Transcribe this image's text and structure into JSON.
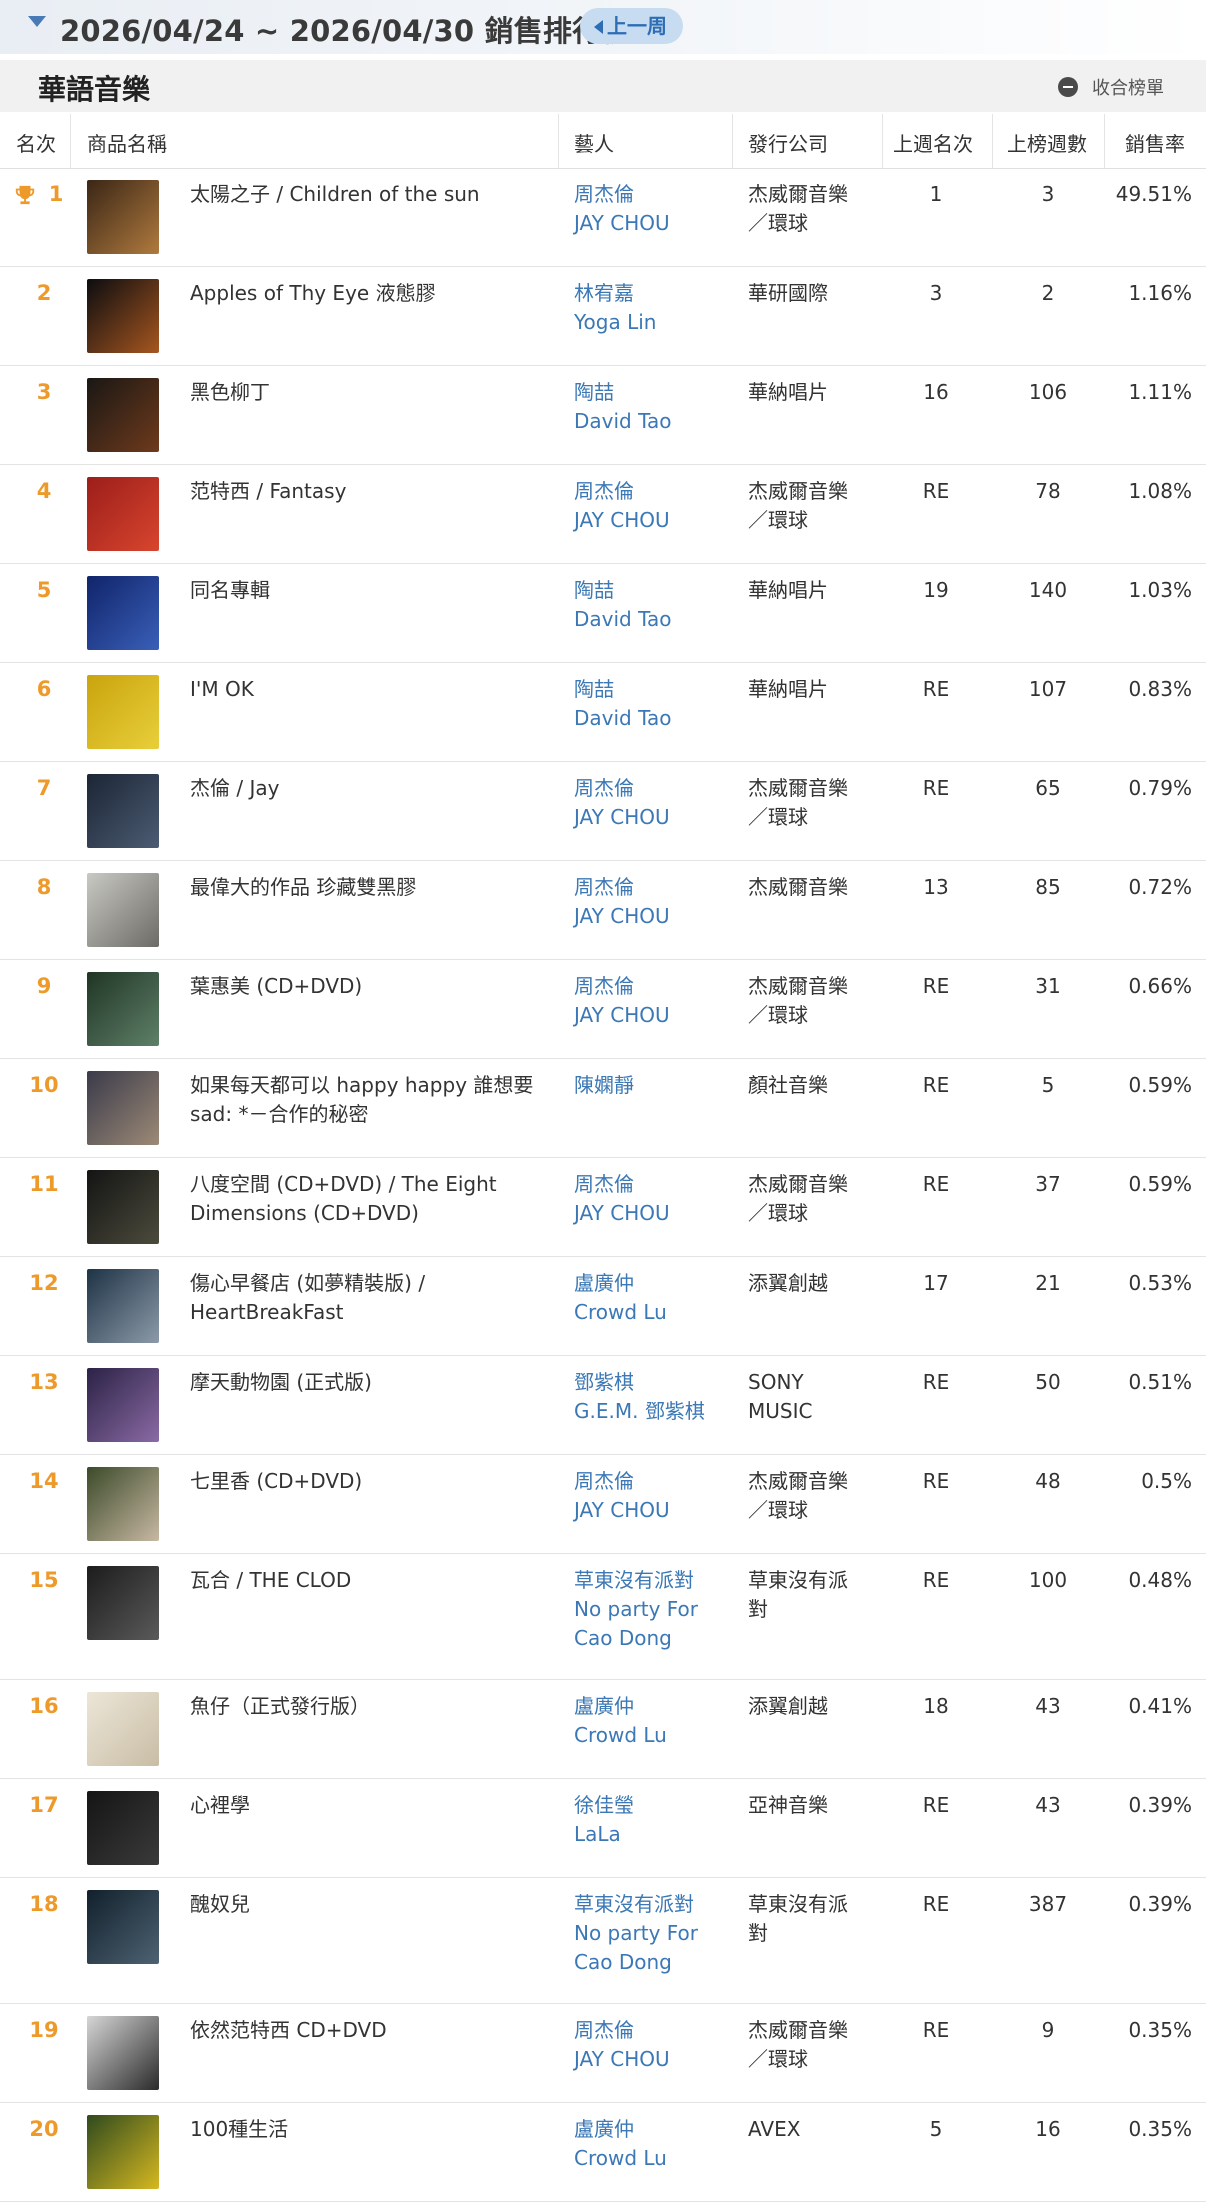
{
  "header": {
    "title": "2026/04/24 ~ 2026/04/30 銷售排行榜",
    "prev_button": "上一周"
  },
  "section": {
    "title": "華語音樂",
    "collapse_label": "收合榜單"
  },
  "columns": {
    "rank": "名次",
    "product": "商品名稱",
    "artist": "藝人",
    "label": "發行公司",
    "last_week": "上週名次",
    "weeks": "上榜週數",
    "sales_rate": "銷售率"
  },
  "colors": {
    "rank": "#ee9a2b",
    "artist_link": "#3b78b5",
    "prev_button_bg": "#c7dcf1"
  },
  "rows": [
    {
      "rank": "1",
      "title": [
        "太陽之子 / Children of the sun"
      ],
      "artist": [
        "周杰倫",
        "JAY CHOU"
      ],
      "label": [
        "杰威爾音樂",
        "／環球"
      ],
      "last_week": "1",
      "weeks": "3",
      "rate": "49.51%",
      "cover": [
        "#3a2616",
        "#b07a3e"
      ]
    },
    {
      "rank": "2",
      "title": [
        "Apples of Thy Eye 液態膠"
      ],
      "artist": [
        "林宥嘉",
        "Yoga Lin"
      ],
      "label": [
        "華研國際"
      ],
      "last_week": "3",
      "weeks": "2",
      "rate": "1.16%",
      "cover": [
        "#0c0c10",
        "#a6561f"
      ]
    },
    {
      "rank": "3",
      "title": [
        "黑色柳丁"
      ],
      "artist": [
        "陶喆",
        "David Tao"
      ],
      "label": [
        "華納唱片"
      ],
      "last_week": "16",
      "weeks": "106",
      "rate": "1.11%",
      "cover": [
        "#1a1714",
        "#6e3a1c"
      ]
    },
    {
      "rank": "4",
      "title": [
        "范特西 / Fantasy"
      ],
      "artist": [
        "周杰倫",
        "JAY CHOU"
      ],
      "label": [
        "杰威爾音樂",
        "／環球"
      ],
      "last_week": "RE",
      "weeks": "78",
      "rate": "1.08%",
      "cover": [
        "#9c1e1a",
        "#d8452e"
      ]
    },
    {
      "rank": "5",
      "title": [
        "同名專輯"
      ],
      "artist": [
        "陶喆",
        "David Tao"
      ],
      "label": [
        "華納唱片"
      ],
      "last_week": "19",
      "weeks": "140",
      "rate": "1.03%",
      "cover": [
        "#10246a",
        "#3a5fb8"
      ]
    },
    {
      "rank": "6",
      "title": [
        "I'M OK"
      ],
      "artist": [
        "陶喆",
        "David Tao"
      ],
      "label": [
        "華納唱片"
      ],
      "last_week": "RE",
      "weeks": "107",
      "rate": "0.83%",
      "cover": [
        "#c9a40e",
        "#e8cf3a"
      ]
    },
    {
      "rank": "7",
      "title": [
        "杰倫 / Jay"
      ],
      "artist": [
        "周杰倫",
        "JAY CHOU"
      ],
      "label": [
        "杰威爾音樂",
        "／環球"
      ],
      "last_week": "RE",
      "weeks": "65",
      "rate": "0.79%",
      "cover": [
        "#1b2535",
        "#4c5c72"
      ]
    },
    {
      "rank": "8",
      "title": [
        "最偉大的作品 珍藏雙黑膠"
      ],
      "artist": [
        "周杰倫",
        "JAY CHOU"
      ],
      "label": [
        "杰威爾音樂"
      ],
      "last_week": "13",
      "weeks": "85",
      "rate": "0.72%",
      "cover": [
        "#c9c9c4",
        "#6c6b66"
      ]
    },
    {
      "rank": "9",
      "title": [
        "葉惠美 (CD+DVD)"
      ],
      "artist": [
        "周杰倫",
        "JAY CHOU"
      ],
      "label": [
        "杰威爾音樂",
        "／環球"
      ],
      "last_week": "RE",
      "weeks": "31",
      "rate": "0.66%",
      "cover": [
        "#1f3524",
        "#5f8069"
      ]
    },
    {
      "rank": "10",
      "title": [
        "如果每天都可以 happy happy 誰想要",
        "sad: *－合作的秘密"
      ],
      "artist": [
        "陳嫻靜"
      ],
      "label": [
        "顏社音樂"
      ],
      "last_week": "RE",
      "weeks": "5",
      "rate": "0.59%",
      "cover": [
        "#3a3a4a",
        "#9c8a76"
      ]
    },
    {
      "rank": "11",
      "title": [
        "八度空間 (CD+DVD) / The Eight",
        "Dimensions (CD+DVD)"
      ],
      "artist": [
        "周杰倫",
        "JAY CHOU"
      ],
      "label": [
        "杰威爾音樂",
        "／環球"
      ],
      "last_week": "RE",
      "weeks": "37",
      "rate": "0.59%",
      "cover": [
        "#141414",
        "#4b4b3c"
      ]
    },
    {
      "rank": "12",
      "title": [
        "傷心早餐店 (如夢精裝版) /",
        "HeartBreakFast"
      ],
      "artist": [
        "盧廣仲",
        "Crowd Lu"
      ],
      "label": [
        "添翼創越"
      ],
      "last_week": "17",
      "weeks": "21",
      "rate": "0.53%",
      "cover": [
        "#1e3346",
        "#8c9aa8"
      ]
    },
    {
      "rank": "13",
      "title": [
        "摩天動物園 (正式版)"
      ],
      "artist": [
        "鄧紫棋",
        "G.E.M. 鄧紫棋"
      ],
      "label": [
        "SONY",
        "MUSIC"
      ],
      "last_week": "RE",
      "weeks": "50",
      "rate": "0.51%",
      "cover": [
        "#2b2246",
        "#8a6aa4"
      ]
    },
    {
      "rank": "14",
      "title": [
        "七里香 (CD+DVD)"
      ],
      "artist": [
        "周杰倫",
        "JAY CHOU"
      ],
      "label": [
        "杰威爾音樂",
        "／環球"
      ],
      "last_week": "RE",
      "weeks": "48",
      "rate": "0.5%",
      "cover": [
        "#3c4a2a",
        "#c7b8a2"
      ]
    },
    {
      "rank": "15",
      "title": [
        "瓦合 / THE CLOD"
      ],
      "artist": [
        "草東沒有派對",
        "No party For",
        "Cao Dong"
      ],
      "label": [
        "草東沒有派",
        "對"
      ],
      "last_week": "RE",
      "weeks": "100",
      "rate": "0.48%",
      "cover": [
        "#1c1c1c",
        "#5a5a5a"
      ]
    },
    {
      "rank": "16",
      "title": [
        "魚仔（正式發行版）"
      ],
      "artist": [
        "盧廣仲",
        "Crowd Lu"
      ],
      "label": [
        "添翼創越"
      ],
      "last_week": "18",
      "weeks": "43",
      "rate": "0.41%",
      "cover": [
        "#ece6d8",
        "#c9bda5"
      ]
    },
    {
      "rank": "17",
      "title": [
        "心裡學"
      ],
      "artist": [
        "徐佳瑩",
        "LaLa"
      ],
      "label": [
        "亞神音樂"
      ],
      "last_week": "RE",
      "weeks": "43",
      "rate": "0.39%",
      "cover": [
        "#151515",
        "#3a3a3a"
      ]
    },
    {
      "rank": "18",
      "title": [
        "醜奴兒"
      ],
      "artist": [
        "草東沒有派對",
        "No party For",
        "Cao Dong"
      ],
      "label": [
        "草東沒有派",
        "對"
      ],
      "last_week": "RE",
      "weeks": "387",
      "rate": "0.39%",
      "cover": [
        "#12202c",
        "#4d6272"
      ]
    },
    {
      "rank": "19",
      "title": [
        "依然范特西 CD+DVD"
      ],
      "artist": [
        "周杰倫",
        "JAY CHOU"
      ],
      "label": [
        "杰威爾音樂",
        "／環球"
      ],
      "last_week": "RE",
      "weeks": "9",
      "rate": "0.35%",
      "cover": [
        "#d6d6d6",
        "#2a2a2a"
      ]
    },
    {
      "rank": "20",
      "title": [
        "100種生活"
      ],
      "artist": [
        "盧廣仲",
        "Crowd Lu"
      ],
      "label": [
        "AVEX"
      ],
      "last_week": "5",
      "weeks": "16",
      "rate": "0.35%",
      "cover": [
        "#2f4a1e",
        "#d6b820"
      ]
    }
  ]
}
